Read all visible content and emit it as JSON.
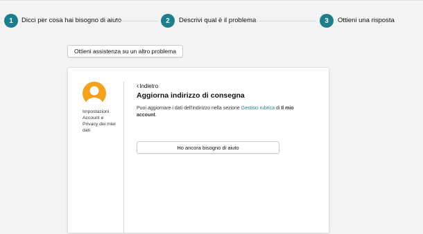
{
  "steps": [
    {
      "number": "1",
      "label": "Dicci per cosa hai bisogno di aiuto"
    },
    {
      "number": "2",
      "label": "Descrivi qual è il problema"
    },
    {
      "number": "3",
      "label": "Ottieni una risposta"
    }
  ],
  "other_problem_button": "Ottieni assistenza su un altro problema",
  "sidebar": {
    "avatar_icon": "user-avatar-icon",
    "lines": [
      "Impostazioni",
      "Account e",
      "Privacy dei miei",
      "dati"
    ]
  },
  "main": {
    "back_label": "Indietro",
    "title": "Aggiorna indirizzo di consegna",
    "description_prefix": "Puoi aggiornare i dati dell'indirizzo nella sezione ",
    "description_link": "Gestisci rubrica",
    "description_middle": " di ",
    "description_bold": "Il mio account",
    "description_suffix": ".",
    "help_button": "Ho ancora bisogno di aiuto"
  },
  "colors": {
    "accent": "#1b7f8e",
    "avatar": "#f4a11c"
  }
}
